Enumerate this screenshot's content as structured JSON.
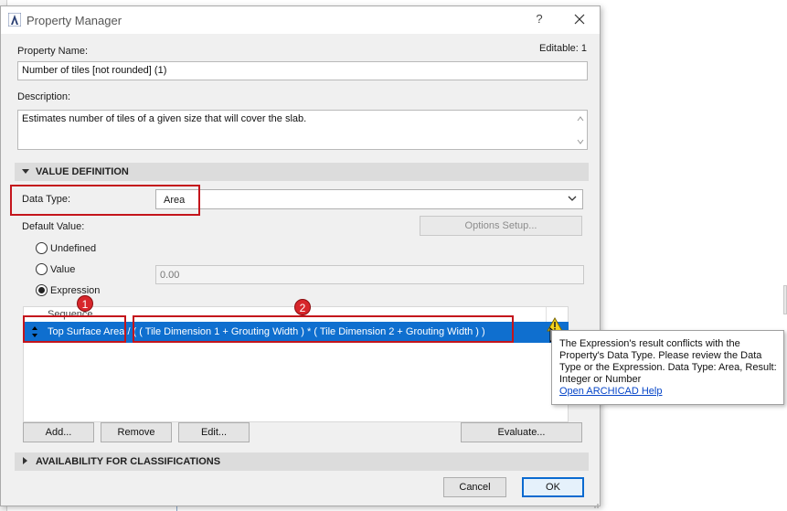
{
  "window": {
    "title": "Property Manager",
    "help_glyph": "?",
    "close_icon": "close-icon",
    "app_icon": "archicad-app-icon"
  },
  "property": {
    "name_label": "Property Name:",
    "editable_label": "Editable: 1",
    "name_value": "Number of tiles [not rounded] (1)",
    "description_label": "Description:",
    "description_value": "Estimates number of tiles of a given size that will cover the slab."
  },
  "value_definition": {
    "section_title": "VALUE DEFINITION",
    "data_type_label": "Data Type:",
    "data_type_value": "Area",
    "default_value_label": "Default Value:",
    "options_setup_label": "Options Setup...",
    "radios": [
      {
        "label": "Undefined",
        "selected": false
      },
      {
        "label": "Value",
        "selected": false
      },
      {
        "label": "Expression",
        "selected": true
      }
    ],
    "value_field": "0.00",
    "expression_header": "Sequence",
    "expression_row_part1": "Top Surface Area",
    "expression_row_part2": " / ( ( Tile Dimension 1 + Grouting Width ) * ( Tile Dimension 2 + Grouting Width ) )",
    "buttons": {
      "add": "Add...",
      "remove": "Remove",
      "edit": "Edit...",
      "evaluate": "Evaluate..."
    }
  },
  "callouts": {
    "badge1": "1",
    "badge2": "2",
    "color": "#c4151c"
  },
  "tooltip": {
    "line1": "The Expression's result conflicts with the",
    "line2": "Property's Data Type. Please review the Data",
    "line3": "Type or the Expression. Data Type: Area, Result:",
    "line4": "Integer or Number",
    "link": "Open ARCHICAD Help",
    "icon": "warning-icon"
  },
  "availability": {
    "section_title": "AVAILABILITY FOR CLASSIFICATIONS"
  },
  "footer": {
    "cancel": "Cancel",
    "ok": "OK"
  },
  "colors": {
    "selection": "#0f6fcf",
    "ok_border": "#0a6ad0",
    "warning": "#f2d21b"
  }
}
